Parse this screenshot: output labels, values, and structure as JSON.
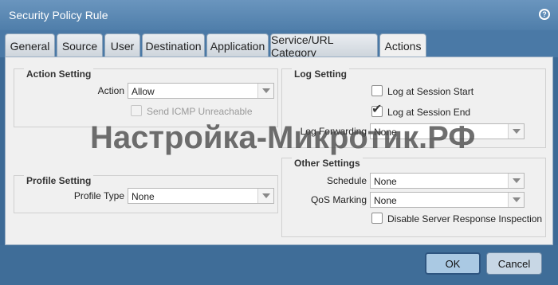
{
  "dialog": {
    "title": "Security Policy Rule"
  },
  "tabs": [
    {
      "label": "General"
    },
    {
      "label": "Source"
    },
    {
      "label": "User"
    },
    {
      "label": "Destination"
    },
    {
      "label": "Application"
    },
    {
      "label": "Service/URL Category"
    },
    {
      "label": "Actions",
      "active": true
    }
  ],
  "action_setting": {
    "title": "Action Setting",
    "action_label": "Action",
    "action_value": "Allow",
    "icmp_label": "Send ICMP Unreachable",
    "icmp_checked": false,
    "icmp_disabled": true
  },
  "profile_setting": {
    "title": "Profile Setting",
    "type_label": "Profile Type",
    "type_value": "None"
  },
  "log_setting": {
    "title": "Log Setting",
    "start_label": "Log at Session Start",
    "start_checked": false,
    "end_label": "Log at Session End",
    "end_checked": true,
    "forwarding_label": "Log Forwarding",
    "forwarding_value": "None"
  },
  "other_settings": {
    "title": "Other Settings",
    "schedule_label": "Schedule",
    "schedule_value": "None",
    "qos_label": "QoS Marking",
    "qos_value": "None",
    "dsri_label": "Disable Server Response Inspection",
    "dsri_checked": false
  },
  "watermark": "Настройка-Микротик.РФ",
  "footer": {
    "ok_label": "OK",
    "cancel_label": "Cancel"
  }
}
